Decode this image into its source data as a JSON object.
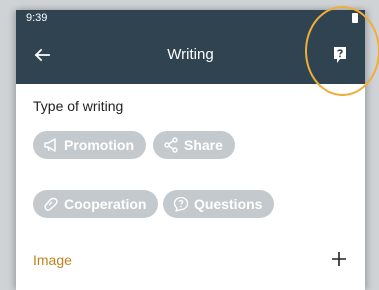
{
  "status_bar": {
    "time": "9:39"
  },
  "app_bar": {
    "title": "Writing",
    "back_icon": "arrow-left-icon",
    "help_icon": "help-document-icon",
    "background": "#2f4450"
  },
  "type_of_writing": {
    "label": "Type of writing",
    "chips": [
      {
        "label": "Promotion",
        "icon": "megaphone-icon"
      },
      {
        "label": "Share",
        "icon": "share-icon"
      },
      {
        "label": "Cooperation",
        "icon": "handshake-icon"
      },
      {
        "label": "Questions",
        "icon": "question-bubble-icon"
      }
    ],
    "chip_color": "#c4c9cd"
  },
  "image_section": {
    "label": "Image",
    "label_color": "#c0841c",
    "action_icon": "plus-icon"
  },
  "highlight_color": "#f0ad3c"
}
